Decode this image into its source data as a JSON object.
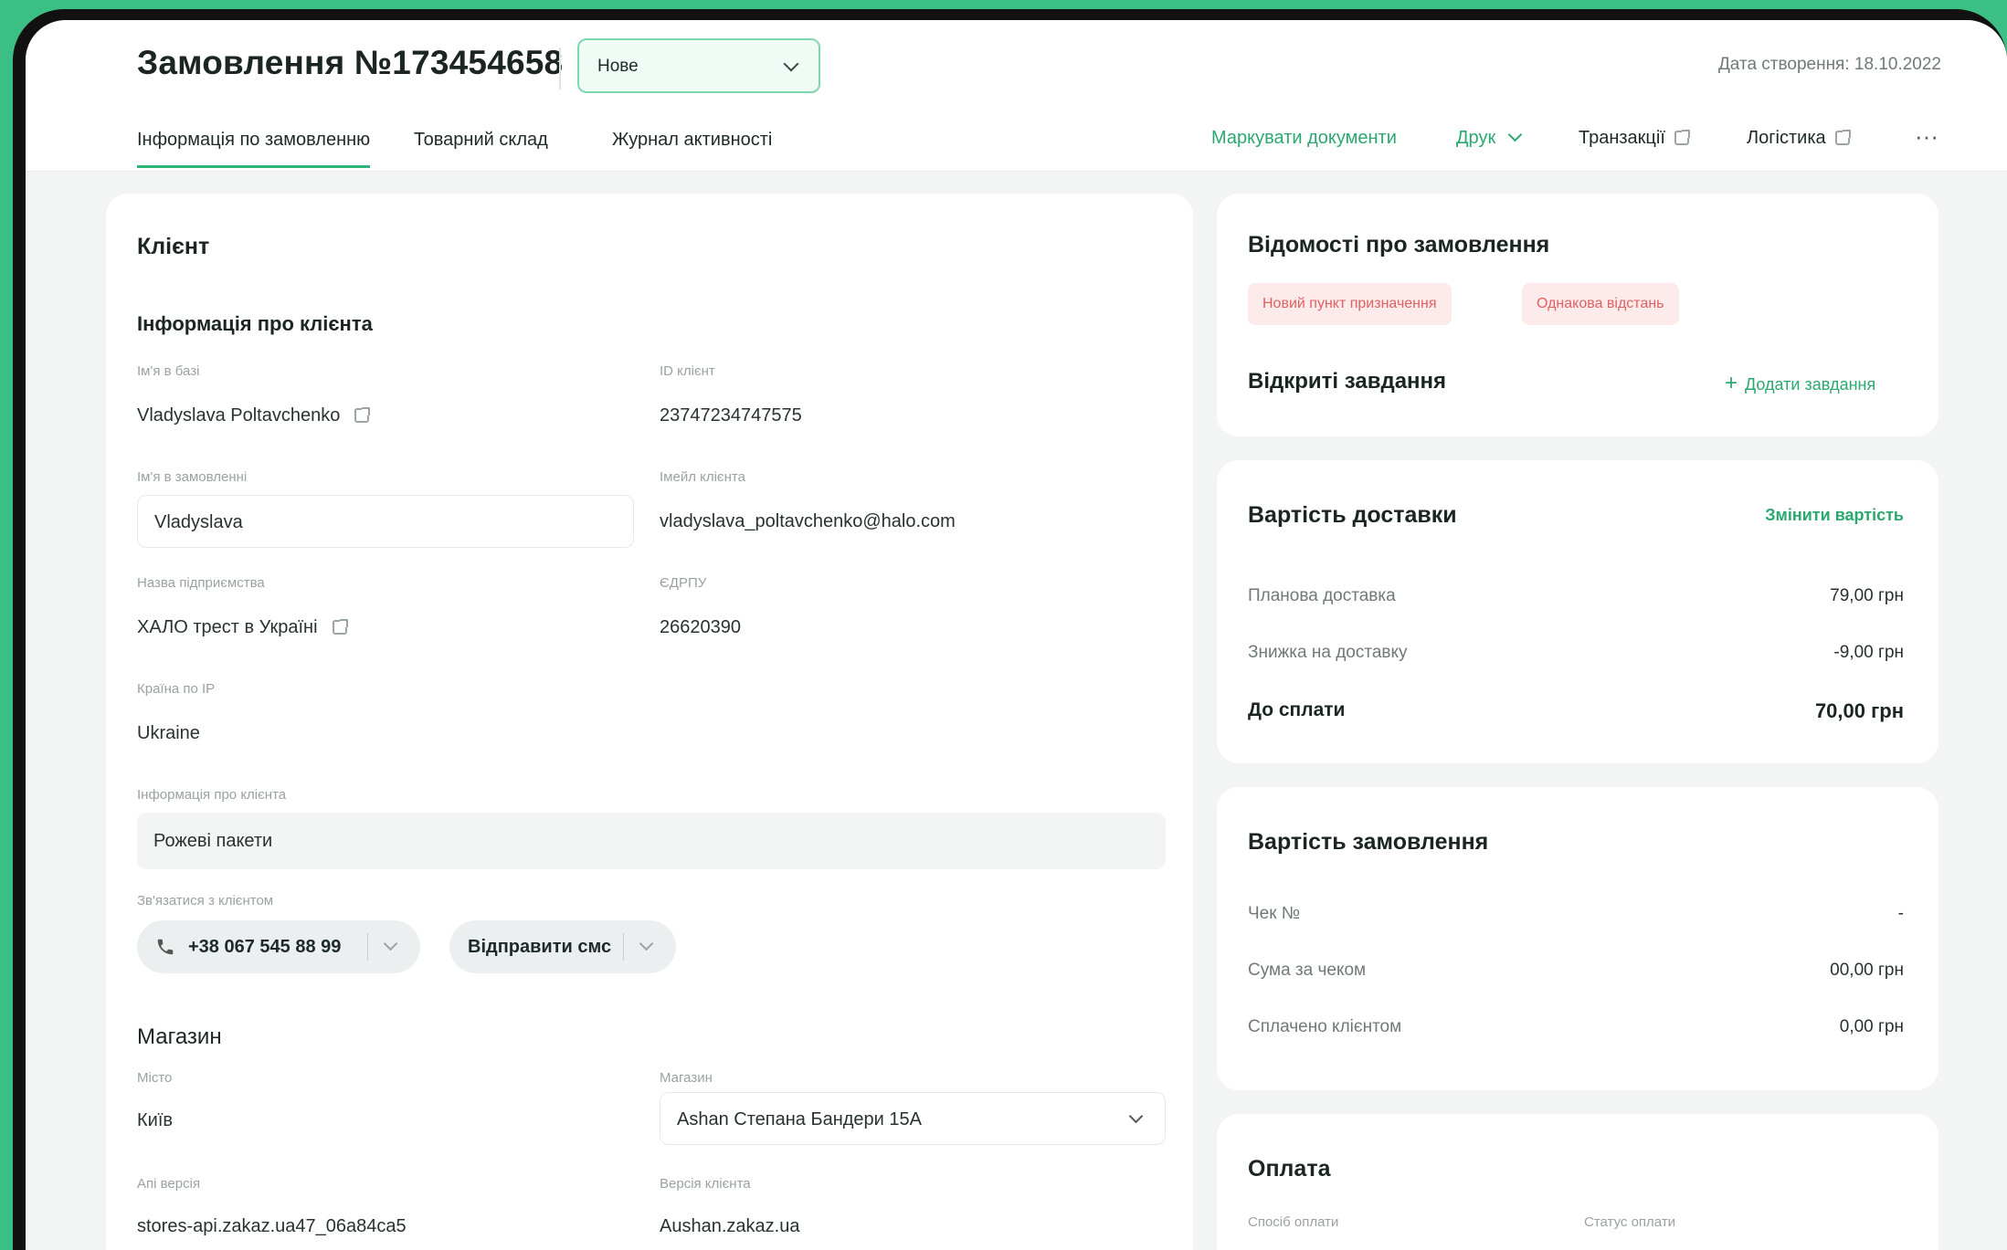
{
  "header": {
    "order_title": "Замовлення №173454658",
    "status_value": "Нове",
    "created_label": "Дата створення:",
    "created_date": "18.10.2022",
    "tabs": [
      {
        "label": "Інформація по замовленню"
      },
      {
        "label": "Товарний склад"
      },
      {
        "label": "Журнал активності"
      }
    ],
    "actions": {
      "mark_documents": "Маркувати документи",
      "print": "Друк",
      "transactions": "Транзакції",
      "logistics": "Логістика",
      "more": "···"
    }
  },
  "client": {
    "title": "Клієнт",
    "info_title": "Інформація про клієнта",
    "name_in_db_label": "Ім'я в базі",
    "name_in_db": "Vladyslava Poltavchenko",
    "client_id_label": "ID клієнт",
    "client_id": "23747234747575",
    "name_in_order_label": "Ім'я в замовленні",
    "name_in_order": "Vladyslava",
    "email_label": "Імейл клієнта",
    "email": "vladyslava_poltavchenko@halo.com",
    "company_label": "Назва підприємства",
    "company": "ХАЛО трест в Україні",
    "edrpou_label": "ЄДРПУ",
    "edrpou": "26620390",
    "country_label": "Країна по IP",
    "country": "Ukraine",
    "client_info_label": "Інформація про клієнта",
    "client_info": "Рожеві пакети",
    "contact_label": "Зв'язатися з клієнтом",
    "phone": "+38 067 545 88 99",
    "send_sms": "Відправити смс"
  },
  "store": {
    "title": "Магазин",
    "city_label": "Місто",
    "city": "Київ",
    "store_label": "Магазин",
    "store": "Ashan Степана Бандери 15А",
    "api_version_label": "Апі версія",
    "api_version": "stores-api.zakaz.ua47_06a84ca5",
    "client_version_label": "Версія клієнта",
    "client_version": "Aushan.zakaz.ua"
  },
  "order_info": {
    "title": "Відомості про замовлення",
    "tags": [
      "Новий пункт призначення",
      "Однакова відстань"
    ],
    "open_tasks": "Відкриті завдання",
    "add_task": "Додати завдання"
  },
  "delivery": {
    "title": "Вартість доставки",
    "change": "Змінити вартість",
    "rows": [
      {
        "label": "Планова доставка",
        "value": "79,00 грн"
      },
      {
        "label": "Знижка на доставку",
        "value": "-9,00 грн"
      }
    ],
    "total_label": "До сплати",
    "total_value": "70,00 грн"
  },
  "order_cost": {
    "title": "Вартість замовлення",
    "rows": [
      {
        "label": "Чек №",
        "value": "-"
      },
      {
        "label": "Сума за чеком",
        "value": "00,00 грн"
      },
      {
        "label": "Сплачено клієнтом",
        "value": "0,00 грн"
      }
    ]
  },
  "payment": {
    "title": "Оплата",
    "method_label": "Спосіб оплати",
    "status_label": "Статус оплати"
  },
  "colors": {
    "accent": "#2aa86f",
    "frame_bg": "#3cbf84",
    "tag_bg": "#fdeaea",
    "tag_text": "#e06161"
  }
}
